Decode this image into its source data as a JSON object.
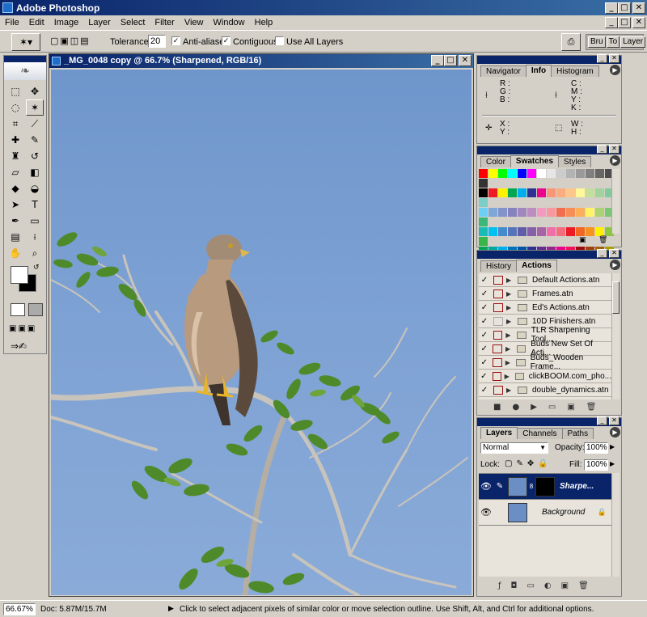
{
  "app": {
    "title": "Adobe Photoshop"
  },
  "menu": [
    "File",
    "Edit",
    "Image",
    "Layer",
    "Select",
    "Filter",
    "View",
    "Window",
    "Help"
  ],
  "options": {
    "tolerance_label": "Tolerance:",
    "tolerance_value": "20",
    "anti_aliased": "Anti-aliased",
    "contiguous": "Contiguous",
    "use_all_layers": "Use All Layers",
    "well_tabs": [
      "Bru",
      "To",
      "Layer"
    ]
  },
  "document": {
    "title": "_MG_0048 copy @ 66.7% (Sharpened, RGB/16)"
  },
  "navigator": {
    "tabs": [
      "Navigator",
      "Info",
      "Histogram"
    ],
    "left": [
      "R :",
      "G :",
      "B :"
    ],
    "right": [
      "C :",
      "M :",
      "Y :",
      "K :"
    ],
    "xy": [
      "X :",
      "Y :"
    ],
    "wh": [
      "W :",
      "H :"
    ]
  },
  "swatches": {
    "tabs": [
      "Color",
      "Swatches",
      "Styles"
    ],
    "colors": [
      [
        "#ff0000",
        "#ffff00",
        "#00ff00",
        "#00ffff",
        "#0000ff",
        "#ff00ff",
        "#ffffff",
        "#e6e6e6",
        "#cccccc",
        "#b3b3b3",
        "#999999",
        "#808080",
        "#666666",
        "#4d4d4d",
        "#333333"
      ],
      [
        "#000000",
        "#ed1c24",
        "#fff200",
        "#00a651",
        "#00aeef",
        "#2e3192",
        "#ec008c",
        "#f7977a",
        "#fbad82",
        "#fdc68c",
        "#fff79a",
        "#c4df9b",
        "#a3d39c",
        "#82ca9d",
        "#7bcdc8"
      ],
      [
        "#6dcff6",
        "#7da7d9",
        "#8393ca",
        "#8781bd",
        "#a187be",
        "#bc8dbf",
        "#f49ac2",
        "#f6989d",
        "#f26c4f",
        "#f68e56",
        "#fbaf5c",
        "#fff467",
        "#acd372",
        "#7cc576",
        "#3bb878"
      ],
      [
        "#1abbb4",
        "#00bff3",
        "#438ccb",
        "#5574b9",
        "#605ca8",
        "#855fa8",
        "#a763a8",
        "#f06ea9",
        "#f26d7d",
        "#ed1c24",
        "#f26522",
        "#f7941d",
        "#fff200",
        "#8dc63f",
        "#39b54a"
      ],
      [
        "#00a651",
        "#00a99d",
        "#00aeef",
        "#0072bc",
        "#0054a6",
        "#2e3192",
        "#662d91",
        "#92278f",
        "#ec008c",
        "#ed145b",
        "#9e0b0f",
        "#a0410d",
        "#a36209",
        "#aba000",
        "#598527"
      ],
      [
        "#197b30",
        "#007236",
        "#00746b",
        "#0076a3",
        "#004a80",
        "#003471",
        "#1b1464",
        "#440e62",
        "#630460",
        "#9e005d",
        "#9e0039",
        "#790000",
        "#7b2e00",
        "#7d4900",
        "#827b00"
      ],
      [
        "#406618",
        "#005e20",
        "#005826",
        "#005952",
        "#005b7f",
        "#003663",
        "#002157",
        "#0d004c",
        "#32004b",
        "#4b0049",
        "#7b0046",
        "#7a0026",
        "#c7b299",
        "#998675",
        "#736357"
      ],
      [
        "#534741",
        "#37302d",
        "#c69c6d",
        "#a67c52",
        "#8c6239",
        "#754c24",
        "#603913",
        "#e8e8e8",
        "#d0d0d0",
        "#b8b8b8",
        "#a0a0a0",
        "#888888",
        "#707070",
        "#585858",
        "#404040"
      ]
    ]
  },
  "actions": {
    "tabs": [
      "History",
      "Actions"
    ],
    "items": [
      "Default Actions.atn",
      "Frames.atn",
      "Ed's Actions.atn",
      "10D Finishers.atn",
      "TLR Sharpening Tool...",
      "Buds New Set Of Acti...",
      "Buds_Wooden Frame...",
      "clickBOOM.com_pho...",
      "double_dynamics.atn"
    ]
  },
  "layers": {
    "tabs": [
      "Layers",
      "Channels",
      "Paths"
    ],
    "blend_mode": "Normal",
    "opacity_label": "Opacity:",
    "opacity_value": "100%",
    "lock_label": "Lock:",
    "fill_label": "Fill:",
    "fill_value": "100%",
    "items": [
      {
        "name": "Sharpe...",
        "selected": true
      },
      {
        "name": "Background",
        "selected": false
      }
    ]
  },
  "status": {
    "zoom": "66.67%",
    "doc": "Doc: 5.87M/15.7M",
    "hint": "Click to select adjacent pixels of similar color or move selection outline.  Use Shift, Alt, and Ctrl for additional options."
  }
}
